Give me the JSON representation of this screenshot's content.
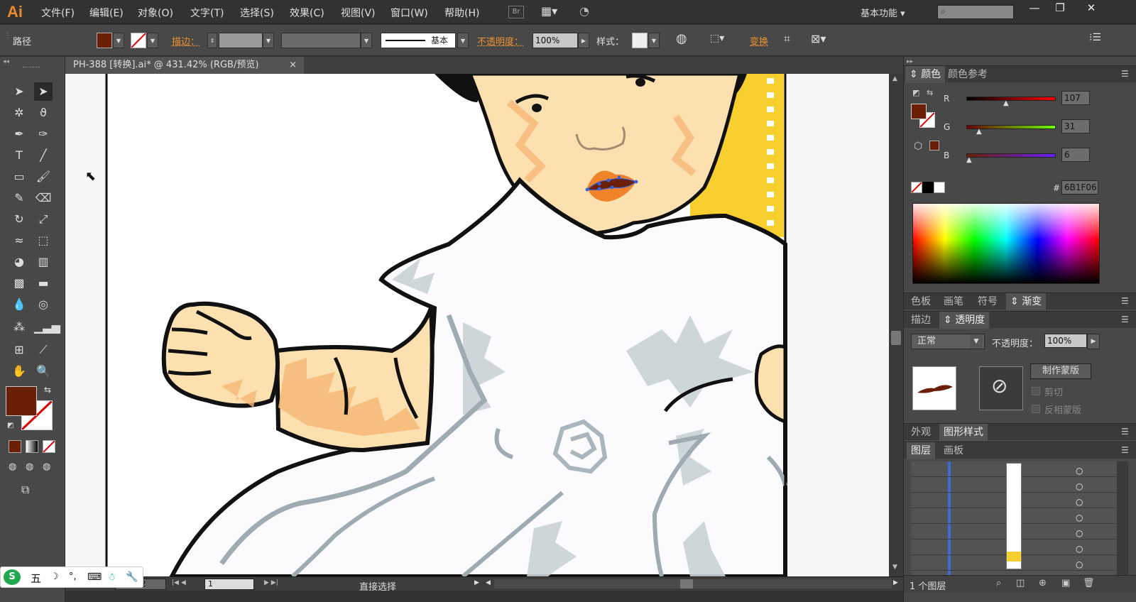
{
  "app": {
    "logo": "Ai",
    "menus": [
      "文件(F)",
      "编辑(E)",
      "对象(O)",
      "文字(T)",
      "选择(S)",
      "效果(C)",
      "视图(V)",
      "窗口(W)",
      "帮助(H)"
    ],
    "br_label": "Br",
    "workspace": "基本功能",
    "search_placeholder": "",
    "window_controls": [
      "—",
      "❐",
      "✕"
    ]
  },
  "control_bar": {
    "selection_type": "路径",
    "stroke_label": "描边：",
    "brush_label": "基本",
    "opacity_label": "不透明度：",
    "opacity_value": "100%",
    "style_label": "样式：",
    "transform_label": "变换",
    "fill_color": "#6B1F06"
  },
  "document": {
    "tab_title": "PH-388 [转换].ai* @ 431.42% (RGB/预览)",
    "tab_close": "×"
  },
  "status_bar": {
    "zoom": "431.42",
    "artboard_number": "1",
    "tool_name": "直接选择"
  },
  "color_panel": {
    "tabs": [
      "颜色",
      "颜色参考"
    ],
    "channels": [
      {
        "name": "R",
        "value": "107",
        "fraction": 0.42
      },
      {
        "name": "G",
        "value": "31",
        "fraction": 0.12
      },
      {
        "name": "B",
        "value": "6",
        "fraction": 0.02
      }
    ],
    "hex_label": "#",
    "hex_value": "6B1F06",
    "current_color": "#6B1F06"
  },
  "swatch_tabs": [
    "色板",
    "画笔",
    "符号",
    "渐变"
  ],
  "transparency_panel": {
    "tabs": [
      "描边",
      "透明度"
    ],
    "blend_mode": "正常",
    "opacity_label": "不透明度：",
    "opacity_value": "100%",
    "make_mask_button": "制作蒙版",
    "clip_label": "剪切",
    "invert_label": "反相蒙版"
  },
  "appearance_tabs": [
    "外观",
    "图形样式"
  ],
  "layers_panel": {
    "tabs": [
      "图层",
      "画板"
    ],
    "footer": "1 个图层"
  },
  "ime_bar": {
    "mode": "五"
  }
}
